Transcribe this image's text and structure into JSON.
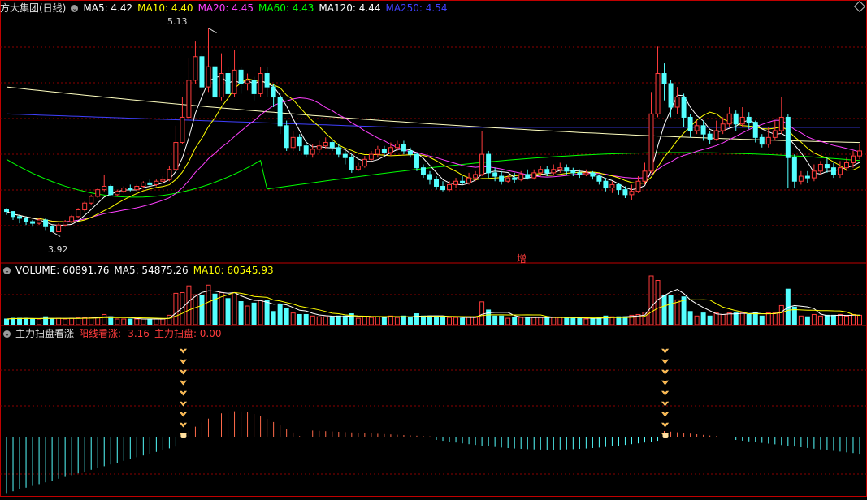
{
  "main_header": {
    "title": "方大集团(日线)",
    "ma_items": [
      {
        "label": "MA5: 4.42",
        "color": "#ffffff"
      },
      {
        "label": "MA10: 4.40",
        "color": "#ffff00"
      },
      {
        "label": "MA20: 4.45",
        "color": "#ff40ff"
      },
      {
        "label": "MA60: 4.43",
        "color": "#00ff00"
      },
      {
        "label": "MA120: 4.44",
        "color": "#ffffff"
      },
      {
        "label": "MA250: 4.54",
        "color": "#4040ff"
      }
    ]
  },
  "annotations": {
    "high_label": "5.13",
    "low_label": "3.92",
    "zeng_label": "增"
  },
  "volume_header": {
    "items": [
      {
        "label": "VOLUME: 60891.76",
        "color": "#ffffff"
      },
      {
        "label": "MA5: 54875.26",
        "color": "#ffffff"
      },
      {
        "label": "MA10: 60545.93",
        "color": "#ffff00"
      }
    ]
  },
  "indicator_header": {
    "title": "主力扫盘看涨",
    "items": [
      {
        "label": "阳线看涨: -3.16",
        "color": "#ff3c3c"
      },
      {
        "label": "主力扫盘: 0.00",
        "color": "#ff3c3c"
      }
    ]
  },
  "colors": {
    "up": "#ff3c3c",
    "down": "#54ffff",
    "grid": "#8b0000",
    "frame": "#c00000",
    "ma5": "#ffffff",
    "ma10": "#ffff00",
    "ma20": "#ff40ff",
    "ma60": "#00ff00",
    "ma120": "#ffffc0",
    "ma250": "#4040ff",
    "signal": "#ffb040"
  },
  "chart_data": {
    "type": "candlestick",
    "title": "方大集团(日线)",
    "price_range": [
      3.85,
      5.2
    ],
    "high": 5.13,
    "low": 3.92,
    "candles": [
      [
        4.05,
        4.04,
        4.06,
        4.02
      ],
      [
        4.04,
        4.01,
        4.04,
        3.99
      ],
      [
        4.01,
        4.0,
        4.02,
        3.97
      ],
      [
        4.0,
        3.98,
        4.01,
        3.96
      ],
      [
        3.98,
        3.97,
        3.99,
        3.95
      ],
      [
        3.97,
        3.99,
        4.0,
        3.96
      ],
      [
        3.99,
        3.95,
        4.0,
        3.93
      ],
      [
        3.95,
        3.92,
        3.96,
        3.92
      ],
      [
        3.92,
        3.96,
        3.97,
        3.92
      ],
      [
        3.96,
        3.98,
        3.99,
        3.95
      ],
      [
        3.98,
        4.01,
        4.02,
        3.97
      ],
      [
        4.01,
        4.05,
        4.06,
        4.0
      ],
      [
        4.05,
        4.09,
        4.1,
        4.04
      ],
      [
        4.09,
        4.13,
        4.14,
        4.08
      ],
      [
        4.13,
        4.17,
        4.18,
        4.12
      ],
      [
        4.17,
        4.19,
        4.26,
        4.16
      ],
      [
        4.19,
        4.14,
        4.2,
        4.13
      ],
      [
        4.14,
        4.16,
        4.17,
        4.13
      ],
      [
        4.16,
        4.18,
        4.19,
        4.15
      ],
      [
        4.18,
        4.17,
        4.2,
        4.16
      ],
      [
        4.17,
        4.19,
        4.2,
        4.16
      ],
      [
        4.19,
        4.21,
        4.22,
        4.18
      ],
      [
        4.21,
        4.2,
        4.23,
        4.19
      ],
      [
        4.2,
        4.22,
        4.23,
        4.19
      ],
      [
        4.22,
        4.23,
        4.25,
        4.21
      ],
      [
        4.23,
        4.29,
        4.31,
        4.22
      ],
      [
        4.29,
        4.45,
        4.55,
        4.28
      ],
      [
        4.45,
        4.6,
        4.72,
        4.44
      ],
      [
        4.6,
        4.82,
        4.95,
        4.58
      ],
      [
        4.82,
        4.96,
        5.05,
        4.8
      ],
      [
        4.96,
        4.78,
        4.98,
        4.74
      ],
      [
        4.78,
        4.9,
        5.13,
        4.75
      ],
      [
        4.9,
        4.72,
        4.92,
        4.66
      ],
      [
        4.72,
        4.86,
        4.98,
        4.7
      ],
      [
        4.86,
        4.74,
        4.9,
        4.7
      ],
      [
        4.74,
        4.88,
        5.0,
        4.72
      ],
      [
        4.88,
        4.8,
        4.9,
        4.74
      ],
      [
        4.8,
        4.82,
        4.86,
        4.76
      ],
      [
        4.82,
        4.74,
        4.84,
        4.7
      ],
      [
        4.74,
        4.86,
        4.9,
        4.72
      ],
      [
        4.86,
        4.78,
        4.9,
        4.72
      ],
      [
        4.78,
        4.72,
        4.8,
        4.66
      ],
      [
        4.72,
        4.55,
        4.74,
        4.5
      ],
      [
        4.55,
        4.42,
        4.58,
        4.4
      ],
      [
        4.42,
        4.48,
        4.52,
        4.4
      ],
      [
        4.48,
        4.43,
        4.5,
        4.4
      ],
      [
        4.43,
        4.38,
        4.46,
        4.36
      ],
      [
        4.38,
        4.41,
        4.44,
        4.36
      ],
      [
        4.41,
        4.43,
        4.46,
        4.39
      ],
      [
        4.43,
        4.45,
        4.48,
        4.41
      ],
      [
        4.45,
        4.42,
        4.47,
        4.4
      ],
      [
        4.42,
        4.38,
        4.44,
        4.36
      ],
      [
        4.38,
        4.36,
        4.4,
        4.32
      ],
      [
        4.36,
        4.29,
        4.38,
        4.27
      ],
      [
        4.29,
        4.31,
        4.33,
        4.28
      ],
      [
        4.31,
        4.35,
        4.37,
        4.3
      ],
      [
        4.35,
        4.38,
        4.4,
        4.34
      ],
      [
        4.38,
        4.41,
        4.43,
        4.36
      ],
      [
        4.41,
        4.39,
        4.43,
        4.37
      ],
      [
        4.39,
        4.42,
        4.45,
        4.37
      ],
      [
        4.42,
        4.44,
        4.46,
        4.4
      ],
      [
        4.44,
        4.4,
        4.46,
        4.38
      ],
      [
        4.4,
        4.38,
        4.42,
        4.36
      ],
      [
        4.38,
        4.3,
        4.39,
        4.28
      ],
      [
        4.3,
        4.26,
        4.32,
        4.24
      ],
      [
        4.26,
        4.23,
        4.28,
        4.2
      ],
      [
        4.23,
        4.19,
        4.25,
        4.17
      ],
      [
        4.19,
        4.17,
        4.22,
        4.16
      ],
      [
        4.17,
        4.2,
        4.22,
        4.16
      ],
      [
        4.2,
        4.22,
        4.24,
        4.18
      ],
      [
        4.22,
        4.21,
        4.25,
        4.2
      ],
      [
        4.21,
        4.24,
        4.27,
        4.2
      ],
      [
        4.24,
        4.26,
        4.28,
        4.22
      ],
      [
        4.26,
        4.38,
        4.52,
        4.25
      ],
      [
        4.38,
        4.27,
        4.4,
        4.24
      ],
      [
        4.27,
        4.25,
        4.3,
        4.22
      ],
      [
        4.25,
        4.22,
        4.28,
        4.2
      ],
      [
        4.22,
        4.24,
        4.26,
        4.21
      ],
      [
        4.24,
        4.23,
        4.27,
        4.21
      ],
      [
        4.23,
        4.26,
        4.28,
        4.22
      ],
      [
        4.26,
        4.24,
        4.29,
        4.23
      ],
      [
        4.24,
        4.27,
        4.29,
        4.23
      ],
      [
        4.27,
        4.29,
        4.31,
        4.25
      ],
      [
        4.29,
        4.27,
        4.31,
        4.25
      ],
      [
        4.27,
        4.29,
        4.32,
        4.26
      ],
      [
        4.29,
        4.3,
        4.33,
        4.27
      ],
      [
        4.3,
        4.28,
        4.32,
        4.26
      ],
      [
        4.28,
        4.27,
        4.3,
        4.25
      ],
      [
        4.27,
        4.26,
        4.29,
        4.24
      ],
      [
        4.26,
        4.27,
        4.29,
        4.25
      ],
      [
        4.27,
        4.25,
        4.28,
        4.23
      ],
      [
        4.25,
        4.22,
        4.26,
        4.2
      ],
      [
        4.22,
        4.18,
        4.24,
        4.16
      ],
      [
        4.18,
        4.2,
        4.22,
        4.15
      ],
      [
        4.2,
        4.17,
        4.21,
        4.14
      ],
      [
        4.17,
        4.14,
        4.19,
        4.12
      ],
      [
        4.14,
        4.16,
        4.2,
        4.11
      ],
      [
        4.16,
        4.22,
        4.25,
        4.15
      ],
      [
        4.22,
        4.28,
        4.33,
        4.2
      ],
      [
        4.28,
        4.62,
        4.75,
        4.27
      ],
      [
        4.62,
        4.86,
        5.02,
        4.6
      ],
      [
        4.86,
        4.8,
        4.92,
        4.7
      ],
      [
        4.8,
        4.66,
        4.82,
        4.6
      ],
      [
        4.66,
        4.72,
        4.78,
        4.62
      ],
      [
        4.72,
        4.6,
        4.74,
        4.54
      ],
      [
        4.6,
        4.52,
        4.62,
        4.48
      ],
      [
        4.52,
        4.55,
        4.58,
        4.5
      ],
      [
        4.55,
        4.5,
        4.58,
        4.46
      ],
      [
        4.5,
        4.47,
        4.52,
        4.44
      ],
      [
        4.47,
        4.52,
        4.58,
        4.46
      ],
      [
        4.52,
        4.56,
        4.6,
        4.5
      ],
      [
        4.56,
        4.62,
        4.66,
        4.54
      ],
      [
        4.62,
        4.56,
        4.64,
        4.52
      ],
      [
        4.56,
        4.6,
        4.66,
        4.54
      ],
      [
        4.6,
        4.57,
        4.63,
        4.53
      ],
      [
        4.57,
        4.48,
        4.58,
        4.45
      ],
      [
        4.48,
        4.44,
        4.5,
        4.42
      ],
      [
        4.44,
        4.48,
        4.54,
        4.42
      ],
      [
        4.48,
        4.52,
        4.58,
        4.46
      ],
      [
        4.52,
        4.6,
        4.72,
        4.5
      ],
      [
        4.6,
        4.36,
        4.62,
        4.18
      ],
      [
        4.36,
        4.22,
        4.38,
        4.18
      ],
      [
        4.22,
        4.25,
        4.28,
        4.2
      ],
      [
        4.25,
        4.24,
        4.28,
        4.21
      ],
      [
        4.24,
        4.28,
        4.32,
        4.22
      ],
      [
        4.28,
        4.32,
        4.34,
        4.26
      ],
      [
        4.32,
        4.3,
        4.36,
        4.27
      ],
      [
        4.3,
        4.26,
        4.33,
        4.24
      ],
      [
        4.26,
        4.3,
        4.34,
        4.24
      ],
      [
        4.3,
        4.33,
        4.36,
        4.28
      ],
      [
        4.33,
        4.37,
        4.4,
        4.3
      ],
      [
        4.37,
        4.4,
        4.44,
        4.35
      ]
    ],
    "volume_ma_labels": [
      "VOLUME: 60891.76",
      "MA5: 54875.26",
      "MA10: 60545.93"
    ]
  }
}
